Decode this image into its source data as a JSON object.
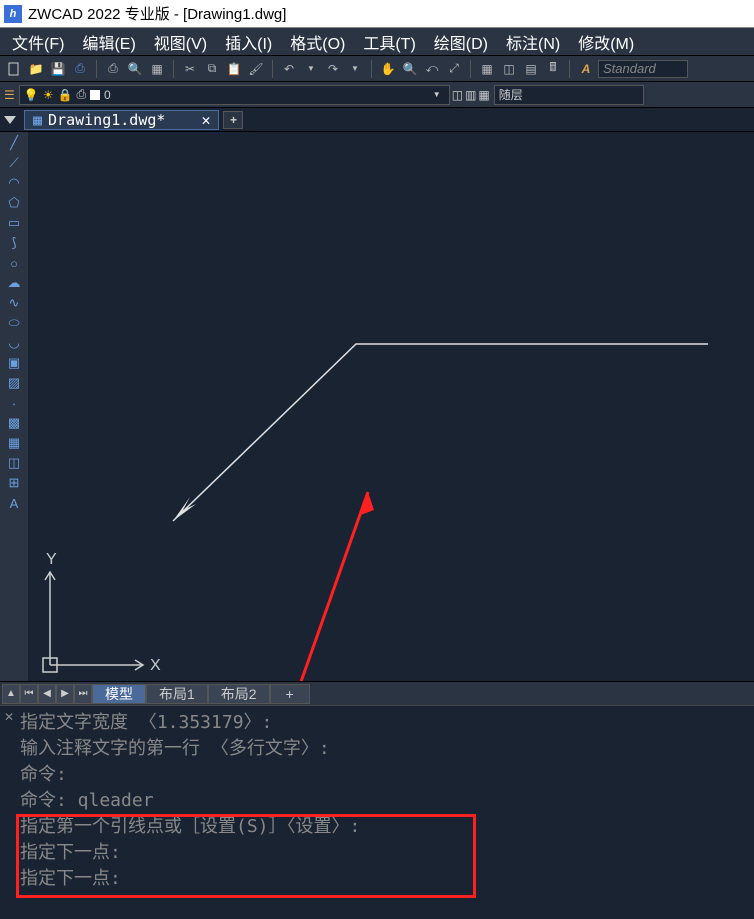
{
  "title": "ZWCAD 2022 专业版 - [Drawing1.dwg]",
  "logo_text": "h",
  "menus": {
    "file": "文件(F)",
    "edit": "编辑(E)",
    "view": "视图(V)",
    "insert": "插入(I)",
    "format": "格式(O)",
    "tools": "工具(T)",
    "draw": "绘图(D)",
    "dimension": "标注(N)",
    "modify": "修改(M)"
  },
  "style_box": "Standard",
  "layer": {
    "name": "0",
    "bylayer": "随层"
  },
  "doc_tab": {
    "label": "Drawing1.dwg*"
  },
  "layout_tabs": {
    "model": "模型",
    "layout1": "布局1",
    "layout2": "布局2",
    "add": "+"
  },
  "ucs": {
    "x": "X",
    "y": "Y"
  },
  "command_lines": [
    "指定文字宽度 〈1.353179〉:",
    "输入注释文字的第一行 〈多行文字〉:",
    "命令:",
    "命令:  qleader",
    "指定第一个引线点或［设置(S)］〈设置〉:",
    "指定下一点:",
    "指定下一点:"
  ]
}
